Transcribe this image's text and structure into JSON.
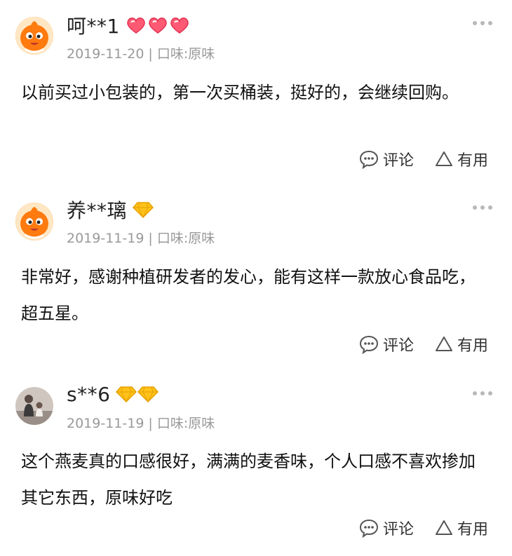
{
  "reviews": [
    {
      "username": "呵**1",
      "badge_icon": "heart-badge-icon",
      "badge_color": "#ff4d6d",
      "date": "2019-11-20",
      "flavor": "口味:原味",
      "content": "以前买过小包装的，第一次买桶装，挺好的，会继续回购。",
      "comment_label": "评论",
      "useful_label": "有用"
    },
    {
      "username": "养**璃",
      "badge_icon": "diamond-badge-icon",
      "badge_color": "#ffb400",
      "date": "2019-11-19",
      "flavor": "口味:原味",
      "content": "非常好，感谢种植研发者的发心，能有这样一款放心食品吃，超五星。",
      "comment_label": "评论",
      "useful_label": "有用"
    },
    {
      "username": "s**6",
      "badge_icon": "diamond-badge-icon",
      "badge_color": "#ffb400",
      "date": "2019-11-19",
      "flavor": "口味:原味",
      "content": "这个燕麦真的口感很好，满满的麦香味，个人口感不喜欢掺加其它东西，原味好吃",
      "comment_label": "评论",
      "useful_label": "有用"
    }
  ]
}
